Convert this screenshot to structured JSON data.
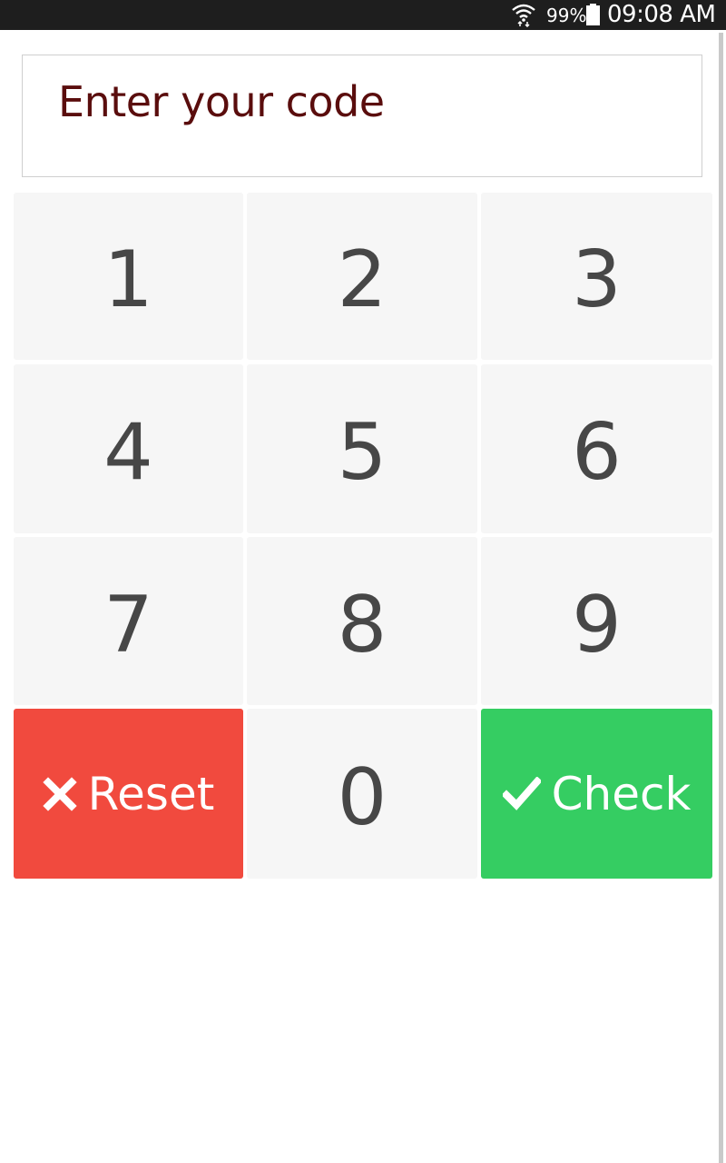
{
  "status_bar": {
    "battery_percent": "99%",
    "time": "09:08 AM",
    "icons": [
      "wifi-icon",
      "battery-icon"
    ]
  },
  "code_display": {
    "prompt": "Enter your code"
  },
  "keypad": {
    "digits": [
      "1",
      "2",
      "3",
      "4",
      "5",
      "6",
      "7",
      "8",
      "9",
      "0"
    ],
    "reset_label": "Reset",
    "check_label": "Check",
    "reset_icon": "close-icon",
    "check_icon": "checkmark-icon"
  },
  "colors": {
    "status_bar_bg": "#1e1e1e",
    "prompt_text": "#5a0d0d",
    "key_bg": "#f6f6f6",
    "key_text": "#474747",
    "reset_bg": "#f14a3e",
    "check_bg": "#35cd62"
  }
}
